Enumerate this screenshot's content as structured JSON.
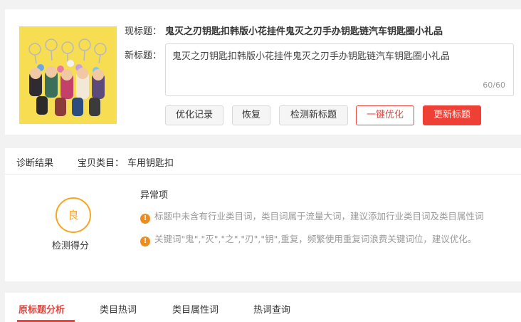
{
  "product": {
    "current_title_label": "现标题：",
    "current_title": "鬼灭之刃钥匙扣韩版小花挂件鬼灭之刃手办钥匙链汽车钥匙圈小礼品",
    "new_title_label": "新标题：",
    "new_title_value": "鬼灭之刃钥匙扣韩版小花挂件鬼灭之刃手办钥匙链汽车钥匙圈小礼品",
    "char_count": "60/60",
    "image": "keychain-product-image"
  },
  "buttons": {
    "history": "优化记录",
    "restore": "恢复",
    "check_new": "检测新标题",
    "one_click": "一键优化",
    "update": "更新标题"
  },
  "diagnosis": {
    "result_label": "诊断结果",
    "category_label": "宝贝类目：",
    "category_value": "车用钥匙扣",
    "score_grade": "良",
    "score_label": "检测得分",
    "abnormal_title": "异常项",
    "warnings": [
      "标题中未含有行业类目词，类目词属于流量大词，建议添加行业类目词及类目属性词",
      "关键词\"鬼\",\"灭\",\"之\",\"刃\",\"钥\",重复，频繁使用重复词浪费关键词位，建议优化。"
    ]
  },
  "tabs": [
    {
      "label": "原标题分析",
      "active": true
    },
    {
      "label": "类目热词",
      "active": false
    },
    {
      "label": "类目属性词",
      "active": false
    },
    {
      "label": "热词查询",
      "active": false
    }
  ],
  "colors": {
    "accent_red": "#ee4035",
    "warning_orange": "#f08c1e",
    "score_orange": "#f5a623",
    "thumb_bg": "#f6dd52"
  },
  "icons": {
    "warning": "exclamation-circle-icon"
  }
}
